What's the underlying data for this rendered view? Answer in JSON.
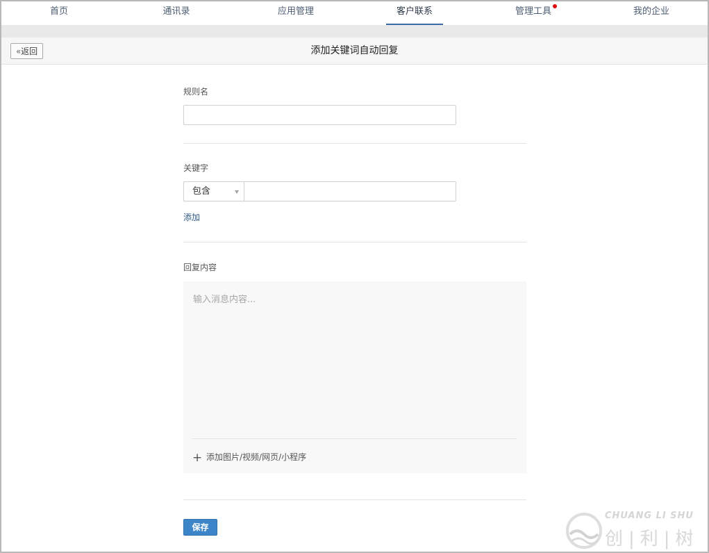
{
  "nav": {
    "items": [
      {
        "label": "首页",
        "active": false,
        "badge": false
      },
      {
        "label": "通讯录",
        "active": false,
        "badge": false
      },
      {
        "label": "应用管理",
        "active": false,
        "badge": false
      },
      {
        "label": "客户联系",
        "active": true,
        "badge": false
      },
      {
        "label": "管理工具",
        "active": false,
        "badge": true
      },
      {
        "label": "我的企业",
        "active": false,
        "badge": false
      }
    ],
    "badge_color": "#e10d0d",
    "active_underline_color": "#3b6aa8"
  },
  "header": {
    "back_label": "返回",
    "back_icon": "double-chevron-left-icon",
    "title": "添加关键词自动回复"
  },
  "form": {
    "rule_name": {
      "label": "规则名",
      "value": "",
      "placeholder": ""
    },
    "keyword": {
      "label": "关键字",
      "match_mode": "包含",
      "value": "",
      "add_link": "添加"
    },
    "reply": {
      "label": "回复内容",
      "value": "",
      "placeholder": "输入消息内容...",
      "add_media_label": "添加图片/视频/网页/小程序",
      "add_media_icon": "plus-icon"
    },
    "save_label": "保存"
  },
  "watermark": {
    "en": "CHUANG LI SHU",
    "cn": "创|利|树"
  },
  "colors": {
    "primary": "#3d85c9",
    "link": "#2f5a86"
  }
}
